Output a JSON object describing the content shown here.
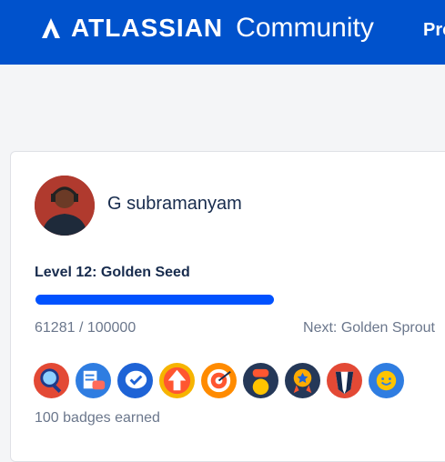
{
  "header": {
    "brand": "ATLASSIAN",
    "community": "Community",
    "nav_cut": "Pro",
    "brand_color": "#0052cc"
  },
  "profile": {
    "name": "G subramanyam",
    "level": "Level 12: Golden Seed",
    "points": "61281 / 100000",
    "next_level": "Next: Golden Sprout",
    "progress": 0.61281,
    "badges_earned": "100 badges earned",
    "badges": [
      "magnifier-badge-icon",
      "document-chat-badge-icon",
      "checkmark-chat-badge-icon",
      "upvote-arrow-badge-icon",
      "target-badge-icon",
      "chat-person-badge-icon",
      "medal-ribbon-badge-icon",
      "badger-badge-icon",
      "sun-smile-badge-icon"
    ]
  }
}
